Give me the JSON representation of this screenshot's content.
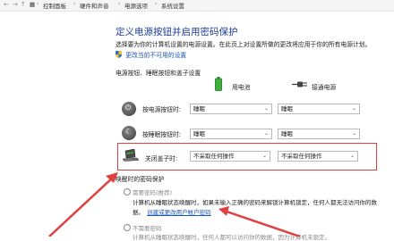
{
  "breadcrumb": {
    "items": [
      "控制面板",
      "硬件和声音",
      "电源选项",
      "系统设置"
    ],
    "sep": "›"
  },
  "page": {
    "title": "定义电源按钮并启用密码保护",
    "description": "选择要为你的计算机设置的电源设置。在此页上对设置所做的更改将应用于你的所有电源计划。",
    "change_unavailable_link": "更改当前不可用的设置",
    "section_heading": "电源按钮、睡眠按钮和盖子设置"
  },
  "columns": {
    "battery": "用电池",
    "plugged_in": "接通电源"
  },
  "rows": [
    {
      "label": "按电源按钮时:",
      "battery": "睡眠",
      "plugged": "睡眠"
    },
    {
      "label": "按睡眠按钮时:",
      "battery": "睡眠",
      "plugged": "睡眠"
    },
    {
      "label": "关闭盖子时:",
      "battery": "不采取任何操作",
      "plugged": "不采取任何操作"
    }
  ],
  "wake": {
    "heading": "唤醒时的密码保护",
    "require_label": "需要密码(推荐)",
    "require_desc": "计算机从睡眠状态唤醒时，如果未输入正确的密码来解锁计算机锁定，任何人都无法访问你的数",
    "require_desc_partial": "据。",
    "create_link": "创建或更改用户帐户密码",
    "no_require_label": "不需要密码",
    "no_require_desc": "计算机从睡眠状态唤醒时，任何人都可以访问你的数据，因为计算机未锁定。"
  },
  "colors": {
    "highlight": "#e04040",
    "link": "#1a55b8",
    "title": "#1e3c96"
  }
}
